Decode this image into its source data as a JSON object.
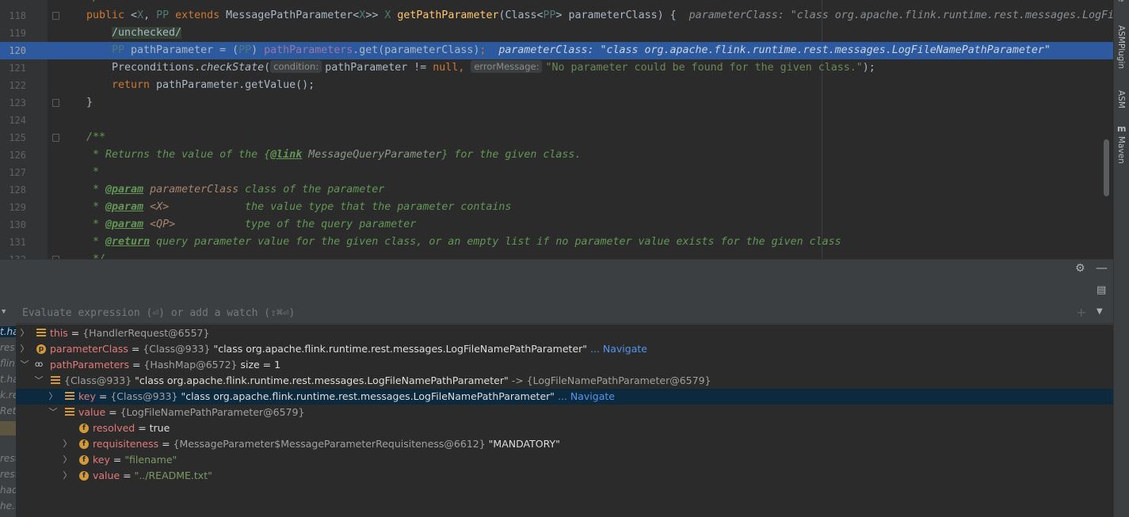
{
  "editor": {
    "selected_line": 120,
    "line_numbers": [
      "118",
      "119",
      "120",
      "121",
      "122",
      "123",
      "124",
      "125",
      "126",
      "127",
      "128",
      "129",
      "130",
      "131",
      "132"
    ],
    "line118": {
      "kw_public": "public",
      "open": " <",
      "tp_x": "X",
      "comma": ", ",
      "tp_pp": "PP",
      "sp1": " ",
      "kw_extends": "extends",
      "rest": " MessagePathParameter<",
      "tp_x2": "X",
      "close": ">> ",
      "tp_x3": "X",
      "sp2": " ",
      "method": "getPathParameter",
      "params": "(Class<",
      "tp_pp2": "PP",
      "params2": "> parameterClass) {",
      "inline": "parameterClass: \"class org.apache.flink.runtime.rest.messages.LogFileNamePathParameter\""
    },
    "line119": "/unchecked/",
    "line120": {
      "tp_pp": "PP",
      "decl": " pathParameter = (",
      "tp_pp2": "PP",
      "close": ") ",
      "field": "pathParameters",
      "call": ".get(parameterClass)",
      "semi": ";",
      "inline": "parameterClass: \"class org.apache.flink.runtime.rest.messages.LogFileNamePathParameter\""
    },
    "line121": {
      "pre": "Preconditions.",
      "method": "checkState",
      "open": "(",
      "hint_condition": "condition:",
      "arg": "pathParameter != ",
      "kw_null": "null",
      "comma": ",",
      "hint_error": "errorMessage:",
      "str": "\"No parameter could be found for the given class.\"",
      "end": ");"
    },
    "line122": {
      "kw_return": "return",
      "rest": " pathParameter.getValue();"
    },
    "line123": "}",
    "line125": "/**",
    "line126": {
      "pre": " * Returns the value of the {",
      "tag": "@link",
      "ref": " MessageQueryParameter",
      "post": "} for the given class."
    },
    "line127": " *",
    "line128": {
      "pre": " * ",
      "tag": "@param",
      "name": " parameterClass",
      "desc": " class of the parameter"
    },
    "line129": {
      "pre": " * ",
      "tag": "@param",
      "name": " <X>",
      "desc": "            the value type that the parameter contains"
    },
    "line130": {
      "pre": " * ",
      "tag": "@param",
      "name": " <QP>",
      "desc": "           type of the query parameter"
    },
    "line131": {
      "pre": " * ",
      "tag": "@return",
      "desc": " query parameter value for the given class, or an empty list if no parameter value exists for the given class"
    },
    "line132": " */"
  },
  "tool_windows": {
    "asm_plugin": "ASMPlugin",
    "asm": "ASM",
    "maven": "Maven"
  },
  "debug": {
    "eval_placeholder": "Evaluate expression (⏎) or add a watch (⇧⌘⏎)",
    "left_fragments": [
      "t.ha",
      "res",
      "flin",
      "t.ha",
      "k.re",
      "Retr",
      "",
      "rest",
      "rest",
      "had",
      "he.f"
    ],
    "variables": [
      {
        "name": "this",
        "eq": " = ",
        "ref": "{HandlerRequest@6557}",
        "value": "",
        "navigate": ""
      },
      {
        "name": "parameterClass",
        "eq": " = ",
        "ref": "{Class@933}",
        "value": " \"class org.apache.flink.runtime.rest.messages.LogFileNamePathParameter\"",
        "navigate": " ... Navigate"
      },
      {
        "name": "pathParameters",
        "eq": " = ",
        "ref": "{HashMap@6572}",
        "value": "  size = 1",
        "navigate": ""
      },
      {
        "ref": "{Class@933}",
        "value": " \"class org.apache.flink.runtime.rest.messages.LogFileNamePathParameter\"",
        "arrow": " -> ",
        "ref2": "{LogFileNamePathParameter@6579}"
      },
      {
        "name": "key",
        "eq": " = ",
        "ref": "{Class@933}",
        "value": " \"class org.apache.flink.runtime.rest.messages.LogFileNamePathParameter\"",
        "navigate": " ... Navigate"
      },
      {
        "name": "value",
        "eq": " = ",
        "ref": "{LogFileNamePathParameter@6579}",
        "value": "",
        "navigate": ""
      },
      {
        "name": "resolved",
        "eq": " = ",
        "ref": "",
        "value": "true",
        "navigate": ""
      },
      {
        "name": "requisiteness",
        "eq": " = ",
        "ref": "{MessageParameter$MessageParameterRequisiteness@6612}",
        "value": " \"MANDATORY\"",
        "navigate": ""
      },
      {
        "name": "key",
        "eq": " = ",
        "ref": "",
        "str": "\"filename\"",
        "navigate": ""
      },
      {
        "name": "value",
        "eq": " = ",
        "ref": "",
        "str": "\"../README.txt\"",
        "navigate": ""
      }
    ]
  },
  "icons": {
    "settings": "gear-icon",
    "minimize": "minimize-icon",
    "layout": "layout-icon",
    "add_watch": "add-icon",
    "dropdown": "chevron-down-icon"
  },
  "colors": {
    "selection": "#2d5a9e",
    "keyword": "#cc7832",
    "string": "#6a8759",
    "field": "#9876aa"
  }
}
